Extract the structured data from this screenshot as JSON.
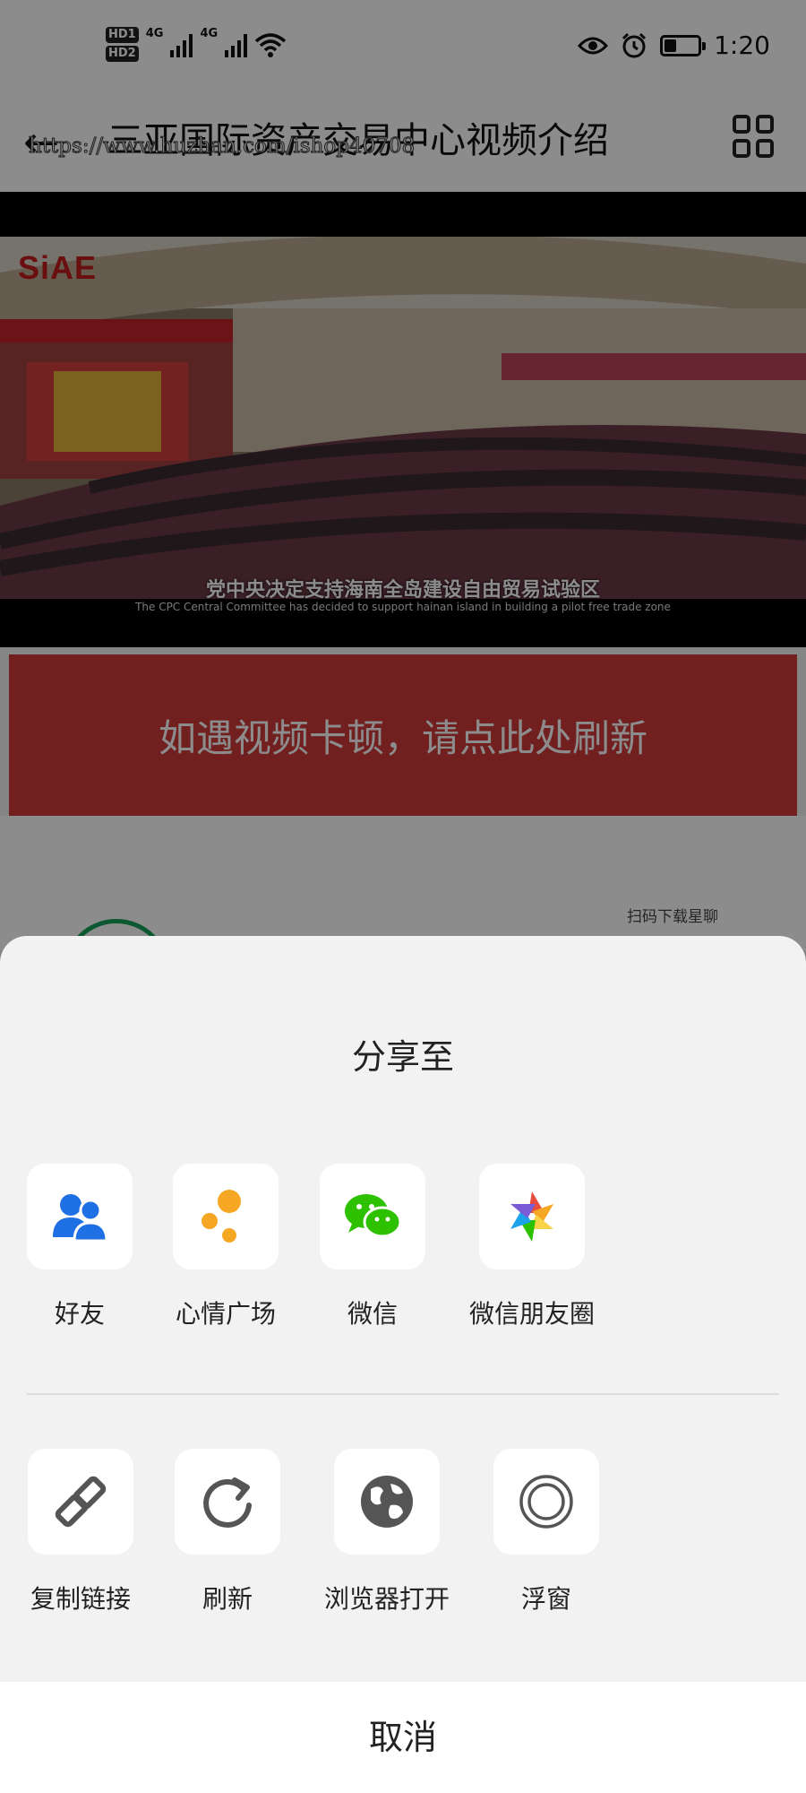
{
  "status_bar": {
    "hd_badges": [
      "HD1",
      "HD2"
    ],
    "network_labels": [
      "4G",
      "4G"
    ],
    "time": "1:20",
    "battery_level": 0.35,
    "icons": [
      "eye-icon",
      "alarm-icon",
      "battery-icon",
      "wifi-icon",
      "signal-icon"
    ]
  },
  "nav": {
    "title": "三亚国际资产交易中心视频介绍",
    "watermark": "https://www.huzhan.com/ishop40708"
  },
  "video": {
    "brand": "SiAE",
    "caption_cn": "党中央决定支持海南全岛建设自由贸易试验区",
    "caption_en": "The CPC Central Committee has decided to support hainan island in building a pilot free trade zone"
  },
  "refresh_banner": {
    "text": "如遇视频卡顿，请点此处刷新"
  },
  "below": {
    "qr_hint": "扫码下载星聊"
  },
  "share_sheet": {
    "title": "分享至",
    "row1": [
      {
        "label": "好友",
        "icon": "friends-icon"
      },
      {
        "label": "心情广场",
        "icon": "mood-square-icon"
      },
      {
        "label": "微信",
        "icon": "wechat-icon"
      },
      {
        "label": "微信朋友圈",
        "icon": "wechat-moments-icon"
      }
    ],
    "row2": [
      {
        "label": "复制链接",
        "icon": "copy-link-icon"
      },
      {
        "label": "刷新",
        "icon": "refresh-icon"
      },
      {
        "label": "浏览器打开",
        "icon": "browser-icon"
      },
      {
        "label": "浮窗",
        "icon": "floating-window-icon"
      }
    ],
    "cancel_label": "取消"
  },
  "colors": {
    "banner_red": "#cf3a3a",
    "friends_blue": "#1f6fe5",
    "mood_orange": "#f5a623",
    "wechat_green": "#2dc100",
    "icon_gray": "#555555"
  }
}
